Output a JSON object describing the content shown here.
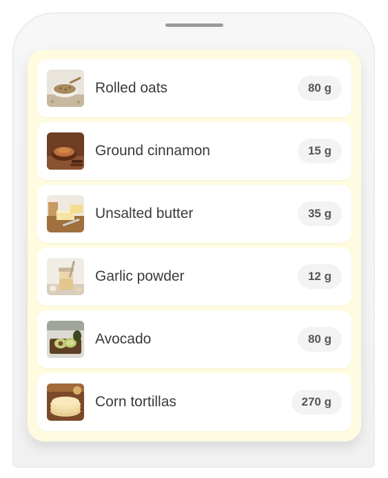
{
  "ingredients": [
    {
      "name": "Rolled oats",
      "quantity": "80 g",
      "icon": "oats-bowl-icon"
    },
    {
      "name": "Ground cinnamon",
      "quantity": "15 g",
      "icon": "cinnamon-bowl-icon"
    },
    {
      "name": "Unsalted butter",
      "quantity": "35 g",
      "icon": "butter-icon"
    },
    {
      "name": "Garlic powder",
      "quantity": "12 g",
      "icon": "garlic-powder-jar-icon"
    },
    {
      "name": "Avocado",
      "quantity": "80 g",
      "icon": "avocado-icon"
    },
    {
      "name": "Corn tortillas",
      "quantity": "270 g",
      "icon": "tortillas-icon"
    }
  ],
  "colors": {
    "card_background": "#fffbe0",
    "row_background": "#ffffff",
    "pill_background": "#f3f3f3",
    "text": "#3a3a3a"
  }
}
